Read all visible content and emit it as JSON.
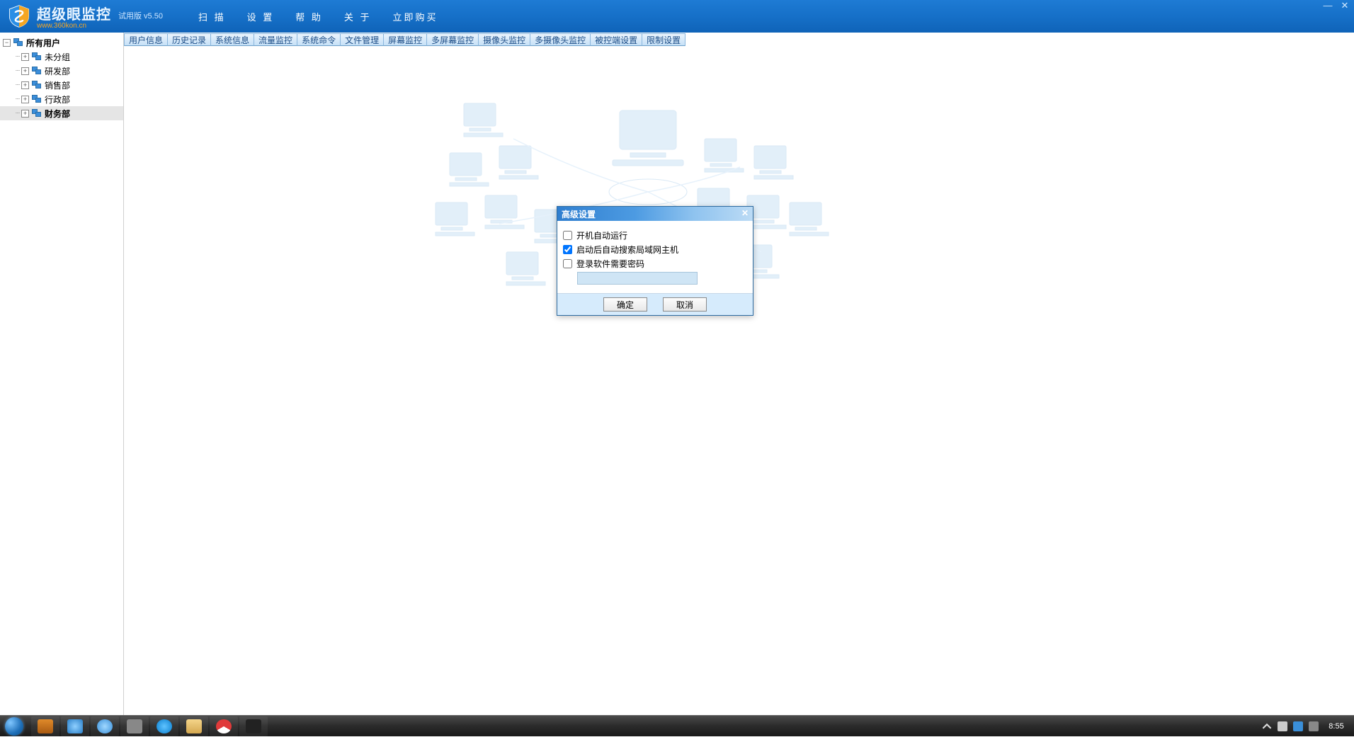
{
  "app": {
    "title": "超级眼监控",
    "url": "www.360kon.cn",
    "version": "试用版 v5.50"
  },
  "menu": [
    "扫 描",
    "设 置",
    "帮 助",
    "关 于",
    "立即购买"
  ],
  "sidebar": {
    "root": "所有用户",
    "items": [
      "未分组",
      "研发部",
      "销售部",
      "行政部",
      "财务部"
    ],
    "selected_index": 4
  },
  "tabs": [
    "用户信息",
    "历史记录",
    "系统信息",
    "流量监控",
    "系统命令",
    "文件管理",
    "屏幕监控",
    "多屏幕监控",
    "摄像头监控",
    "多摄像头监控",
    "被控端设置",
    "限制设置"
  ],
  "dialog": {
    "title": "高级设置",
    "options": [
      {
        "label": "开机自动运行",
        "checked": false
      },
      {
        "label": "启动后自动搜索局域网主机",
        "checked": true
      },
      {
        "label": "登录软件需要密码",
        "checked": false
      }
    ],
    "ok": "确定",
    "cancel": "取消"
  },
  "taskbar": {
    "clock": "8:55"
  }
}
